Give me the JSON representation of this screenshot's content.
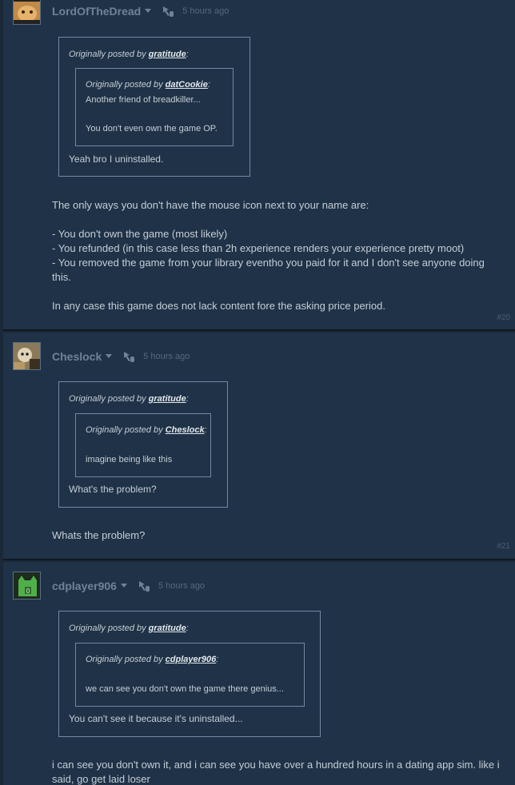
{
  "posts": [
    {
      "username": "LordOfTheDread",
      "time": "5 hours ago",
      "outer_quote": {
        "prefix": "Originally posted by ",
        "author": "gratitude",
        "suffix": ":",
        "text": "Yeah bro I uninstalled."
      },
      "inner_quote": {
        "prefix": "Originally posted by ",
        "author": "datCookie",
        "suffix": ":",
        "line1": "Another friend of breadkiller...",
        "line2": "You don't even own the game OP."
      },
      "body": "The only ways you don't have the mouse icon next to your name are:\n\n- You don't own the game (most likely)\n- You refunded (in this case less than 2h experience renders your experience pretty moot)\n- You removed the game from your library eventho you paid for it and I don't see anyone doing this.\n\nIn any case this game does not lack content fore the asking price period.",
      "number": "#20"
    },
    {
      "username": "Cheslock",
      "time": "5 hours ago",
      "outer_quote": {
        "prefix": "Originally posted by ",
        "author": "gratitude",
        "suffix": ":",
        "text": "What's the problem?"
      },
      "inner_quote": {
        "prefix": "Originally posted by ",
        "author": "Cheslock",
        "suffix": ":",
        "line1": "imagine being like this"
      },
      "body": "Whats the problem?",
      "number": "#21"
    },
    {
      "username": "cdplayer906",
      "time": "5 hours ago",
      "outer_quote": {
        "prefix": "Originally posted by ",
        "author": "gratitude",
        "suffix": ":",
        "text": "You can't see it because it's uninstalled..."
      },
      "inner_quote": {
        "prefix": "Originally posted by ",
        "author": "cdplayer906",
        "suffix": ":",
        "line1": "we can see you don't own the game there genius..."
      },
      "body": "i can see you don't own it, and i can see you have over a hundred hours in a dating app sim. like i said, go get laid loser"
    }
  ],
  "colors": {
    "page_bg": "#1b2838",
    "post_bg": "#1f3247",
    "quote_border": "#7089a3",
    "username": "#6f8397"
  },
  "icons": {
    "mouse": "mouse-icon",
    "dropdown": "chevron-down-icon"
  }
}
